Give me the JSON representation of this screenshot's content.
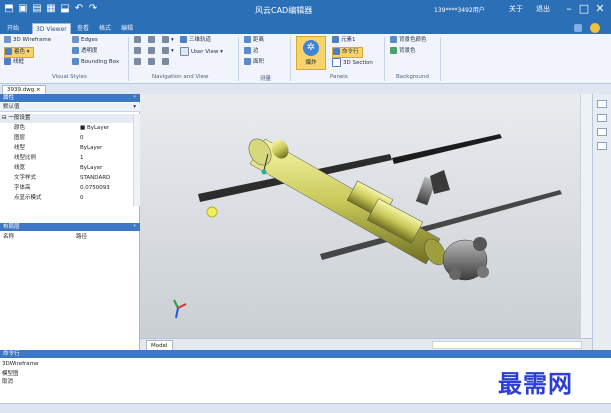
{
  "title_bar": {
    "app_title": "风云CAD编辑器",
    "user_info": "139****3492用户",
    "btn_about": "关于",
    "btn_exit": "退出"
  },
  "tabs": [
    {
      "label": "开始"
    },
    {
      "label": "3D Viewer"
    },
    {
      "label": "查看"
    },
    {
      "label": "格式"
    },
    {
      "label": "编辑"
    }
  ],
  "ribbon": {
    "visual_styles": {
      "group_label": "Visual Styles",
      "wireframe": "3D Wireframe",
      "edges": "Edges",
      "shaded": "着色",
      "transparent": "透明度",
      "outline": "线框",
      "bounding_box": "Bounding Box"
    },
    "navigation": {
      "group_label": "Navigation and View",
      "orbit": "三维轨道",
      "user_view": "User View"
    },
    "measure": {
      "group_label": "测量",
      "distance": "距离",
      "edge": "边",
      "area": "面积"
    },
    "panels": {
      "group_label": "Panels",
      "explode": "爆炸",
      "props": "元素1",
      "cmd_line": "命令行",
      "section": "3D Section"
    },
    "background": {
      "group_label": "Background",
      "bg_color": "背景色颜色",
      "bg_sub": "背景色"
    }
  },
  "document": {
    "tab": "3939.dwg"
  },
  "properties": {
    "header": "属性",
    "selector": "默认值",
    "section": "一般设置",
    "rows": [
      {
        "name": "颜色",
        "value": "■ ByLayer"
      },
      {
        "name": "图层",
        "value": "0"
      },
      {
        "name": "线型",
        "value": "ByLayer"
      },
      {
        "name": "线型比例",
        "value": "1"
      },
      {
        "name": "线宽",
        "value": "ByLayer"
      },
      {
        "name": "文字样式",
        "value": "STANDARD"
      },
      {
        "name": "字体高",
        "value": "0.0750093"
      },
      {
        "name": "点显示模式",
        "value": "0"
      }
    ]
  },
  "layers_panel": {
    "header": "布局层",
    "col_name": "名称",
    "col_path": "路径"
  },
  "model_tab": "Model",
  "command": {
    "header": "命令行",
    "lines": [
      "3DWireframe",
      "模型图",
      "取消"
    ]
  },
  "watermark": "最需网"
}
